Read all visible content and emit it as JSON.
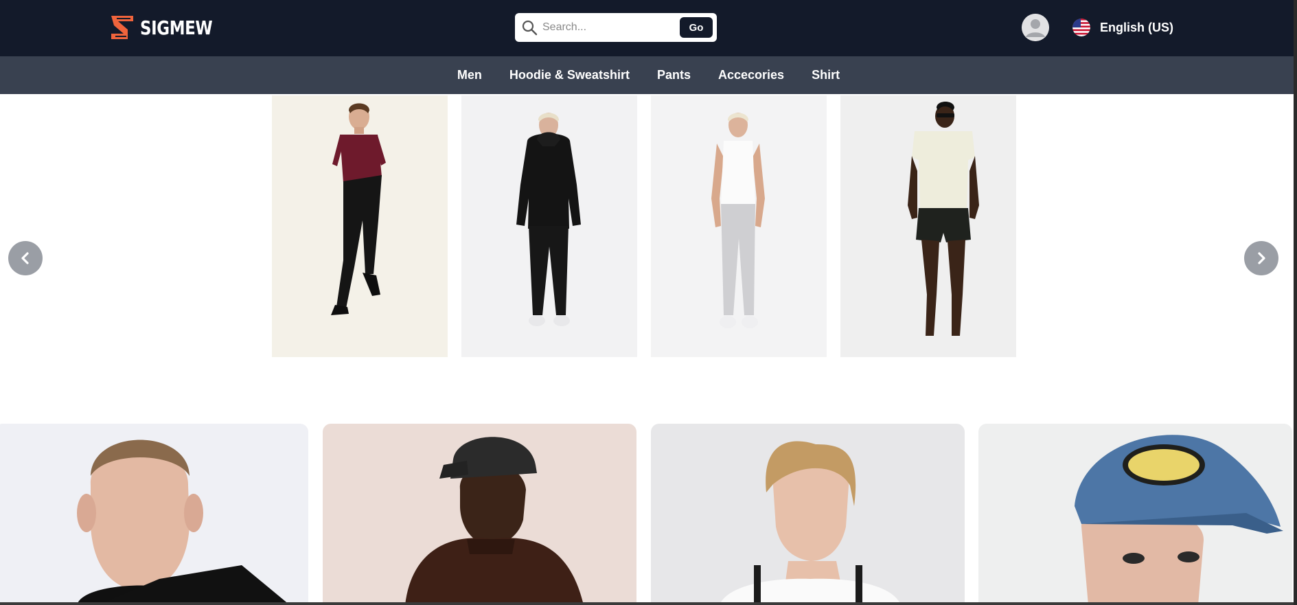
{
  "brand": {
    "name": "SIGMEW",
    "accent_color": "#f0643c"
  },
  "search": {
    "placeholder": "Search...",
    "button_label": "Go"
  },
  "user": {
    "avatar_icon": "user-avatar-icon"
  },
  "language": {
    "label": "English (US)",
    "flag_icon": "us-flag-icon"
  },
  "categories": [
    {
      "label": "Men"
    },
    {
      "label": "Hoodie & Sweatshirt"
    },
    {
      "label": "Pants"
    },
    {
      "label": "Accecories"
    },
    {
      "label": "Shirt"
    }
  ],
  "carousel": {
    "prev_icon": "chevron-left-icon",
    "next_icon": "chevron-right-icon",
    "slides": [
      {
        "image": "model-maroon-polo-black-trousers"
      },
      {
        "image": "model-black-hoodie-black-joggers"
      },
      {
        "image": "model-white-tank-grey-joggers"
      },
      {
        "image": "model-cream-tee-black-shorts"
      }
    ]
  },
  "featured": [
    {
      "image": "portrait-blond-man-black-tee"
    },
    {
      "image": "portrait-man-black-cap-brown-tee"
    },
    {
      "image": "portrait-man-white-shirt-suspenders"
    },
    {
      "image": "portrait-man-denim-ideal-cap"
    }
  ],
  "colors": {
    "header_bg": "#131a2a",
    "nav_bg": "#394150",
    "arrow_bg": "#9a9ea5"
  }
}
